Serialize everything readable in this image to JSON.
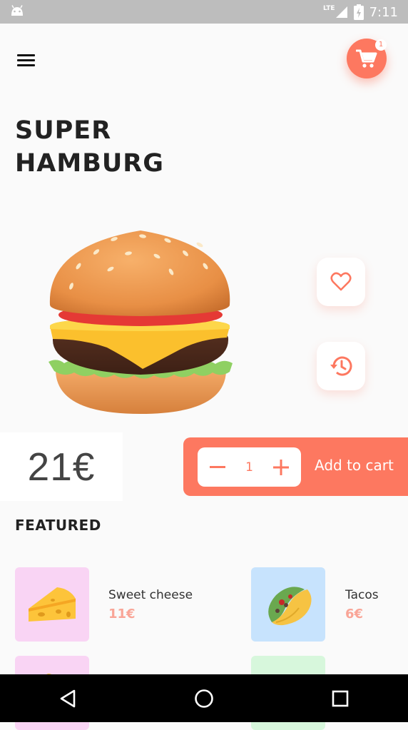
{
  "status_bar": {
    "time": "7:11",
    "network": "LTE"
  },
  "header": {
    "cart_count": "1"
  },
  "product": {
    "title_line1": "SUPER",
    "title_line2": "HAMBURG",
    "price": "21€"
  },
  "order": {
    "quantity": "1",
    "add_label": "Add to cart"
  },
  "featured": {
    "heading": "FEATURED",
    "items": [
      {
        "name": "Sweet cheese",
        "price": "11€",
        "tile_color": "#f9d4f4"
      },
      {
        "name": "Tacos",
        "price": "6€",
        "tile_color": "#c7e3fd"
      },
      {
        "name": "",
        "price": "",
        "tile_color": "#f9d4f4"
      },
      {
        "name": "",
        "price": "",
        "tile_color": "#d7f7dc"
      }
    ]
  },
  "colors": {
    "accent": "#fd7860",
    "price_accent": "#f9a597",
    "background": "#fafafa"
  },
  "icons": [
    "menu-icon",
    "cart-icon",
    "heart-icon",
    "history-icon",
    "minus-icon",
    "plus-icon",
    "back-icon",
    "home-icon",
    "recents-icon"
  ]
}
